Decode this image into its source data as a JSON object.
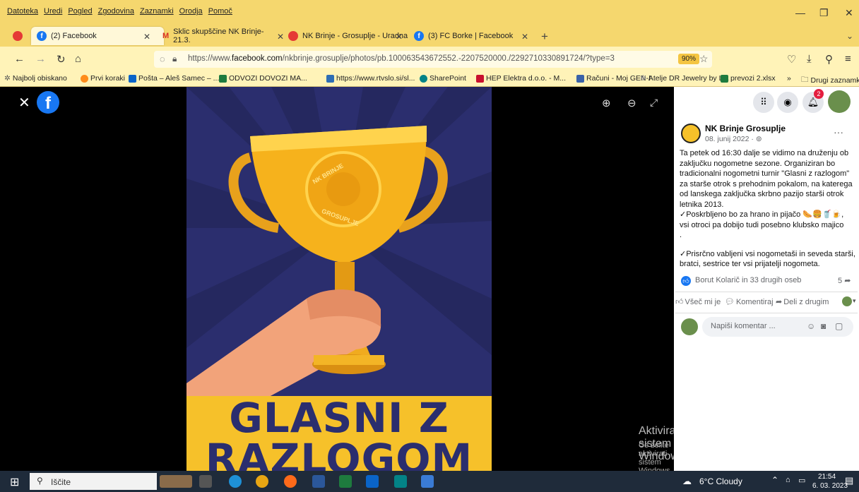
{
  "menu": [
    "Datoteka",
    "Uredi",
    "Pogled",
    "Zgodovina",
    "Zaznamki",
    "Orodja",
    "Pomoč"
  ],
  "tabs": [
    {
      "label": "(2) Facebook",
      "active": true
    },
    {
      "label": "Sklic skupščine NK Brinje- 21.3.",
      "active": false
    },
    {
      "label": "NK Brinje - Grosuplje - Uradna",
      "active": false
    },
    {
      "label": "(3) FC Borke | Facebook",
      "active": false
    }
  ],
  "nav": {
    "url_prefix": "https://www.",
    "url_domain": "facebook.com",
    "url_path": "/nkbrinje.grosuplje/photos/pb.100063543672552.-2207520000./2292710330891724/?type=3",
    "zoom": "90%"
  },
  "bookmarks": [
    "Najbolj obiskano",
    "Prvi koraki",
    "Pošta – Aleš Samec – ...",
    "ODVOZI DOVOZI MA...",
    "https://www.rtvslo.si/sl...",
    "SharePoint",
    "HEP Elektra d.o.o. - M...",
    "Računi - Moj GEN-I",
    "Atelje DR Jewelry by L...",
    "prevozi 2.xlsx"
  ],
  "bookmarks_more": "Drugi zaznamki",
  "poster": {
    "badge_top": "NK BRINJE",
    "badge_bottom": "GROSUPLJE",
    "title_line1": "GLASNI Z",
    "title_line2": "RAZLOGOM"
  },
  "post": {
    "page_name": "NK Brinje Grosuplje",
    "date": "08. junij 2022 ·",
    "text1": "Ta petek od 16:30 dalje se vidimo na druženju ob zaključku nogometne sezone. Organiziran bo tradicionalni nogometni turnir \"Glasni z razlogom\" za starše otrok s prehodnim pokalom, na katerega od lanskega zaključka skrbno pazijo starši otrok letnika 2013.",
    "text2": "✓Poskrbljeno bo za hrano in pijačo 🌭🍔🥤🍺,",
    "text3": "vsi otroci pa dobijo tudi posebno klubsko majico",
    "text4": ".",
    "text5": "✓Prisrčno vabljeni vsi nogometaši in seveda starši, bratci, sestrice ter vsi prijatelji nogometa.",
    "reactions": "Borut Kolarič in 33 drugih oseb",
    "shares": "5",
    "like": "Všeč mi je",
    "comment": "Komentiraj",
    "share": "Deli z drugim",
    "comment_placeholder": "Napiši komentar ..."
  },
  "notifications_count": "2",
  "watermark": {
    "title": "Aktivirajte sistem Windows",
    "subtitle": "Če želite aktivirati sistem Windows, odprite nastavitve."
  },
  "taskbar": {
    "search": "Iščite",
    "weather": "6°C Cloudy",
    "time": "21:54",
    "date": "6. 03. 2023"
  },
  "colors": {
    "accent": "#1877f2",
    "firefox_bar": "#f5d76e",
    "poster_bg": "#2b2e6e",
    "poster_yellow": "#f6c12a"
  }
}
